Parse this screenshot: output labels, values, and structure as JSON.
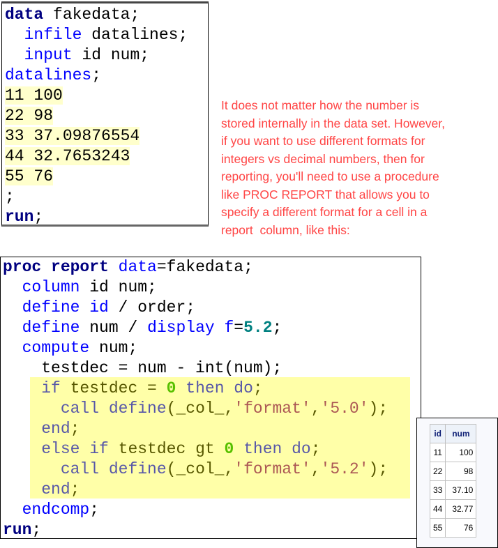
{
  "code1": {
    "lines": [
      [
        {
          "t": "data",
          "k": "kw"
        },
        {
          "t": " fakedata;",
          "k": "plain"
        }
      ],
      [
        {
          "t": "  ",
          "k": "plain"
        },
        {
          "t": "infile",
          "k": "blue"
        },
        {
          "t": " datalines;",
          "k": "plain"
        }
      ],
      [
        {
          "t": "  ",
          "k": "plain"
        },
        {
          "t": "input",
          "k": "blue"
        },
        {
          "t": " id num;",
          "k": "plain"
        }
      ],
      [
        {
          "t": "datalines",
          "k": "blue"
        },
        {
          "t": ";",
          "k": "plain"
        }
      ],
      [
        {
          "t": "11 100",
          "k": "plain hl-data"
        }
      ],
      [
        {
          "t": "22 98",
          "k": "plain hl-data"
        }
      ],
      [
        {
          "t": "33 37.09876554",
          "k": "plain hl-data"
        }
      ],
      [
        {
          "t": "44 32.7653243",
          "k": "plain hl-data"
        }
      ],
      [
        {
          "t": "55 76",
          "k": "plain hl-data"
        }
      ],
      [
        {
          "t": ";",
          "k": "plain"
        }
      ],
      [
        {
          "t": "run",
          "k": "kw"
        },
        {
          "t": ";",
          "k": "plain"
        }
      ]
    ]
  },
  "code2": {
    "lines": [
      [
        {
          "t": "proc report",
          "k": "kw"
        },
        {
          "t": " ",
          "k": "plain"
        },
        {
          "t": "data",
          "k": "blue"
        },
        {
          "t": "=fakedata;",
          "k": "plain"
        }
      ],
      [
        {
          "t": "  ",
          "k": "plain"
        },
        {
          "t": "column",
          "k": "blue"
        },
        {
          "t": " id num;",
          "k": "plain"
        }
      ],
      [
        {
          "t": "  ",
          "k": "plain"
        },
        {
          "t": "define id",
          "k": "blue"
        },
        {
          "t": " / order;",
          "k": "plain"
        }
      ],
      [
        {
          "t": "  ",
          "k": "plain"
        },
        {
          "t": "define",
          "k": "blue"
        },
        {
          "t": " num / ",
          "k": "plain"
        },
        {
          "t": "display f",
          "k": "blue"
        },
        {
          "t": "=",
          "k": "plain"
        },
        {
          "t": "5.2",
          "k": "num"
        },
        {
          "t": ";",
          "k": "plain"
        }
      ],
      [
        {
          "t": "  ",
          "k": "plain"
        },
        {
          "t": "compute",
          "k": "blue"
        },
        {
          "t": " num;",
          "k": "plain"
        }
      ],
      [
        {
          "t": "    testdec = num - int(num);",
          "k": "plain"
        }
      ],
      [
        {
          "t": "    ",
          "k": "plain"
        },
        {
          "t": "if",
          "k": "blue"
        },
        {
          "t": " testdec = ",
          "k": "plain"
        },
        {
          "t": "0",
          "k": "zero"
        },
        {
          "t": " ",
          "k": "plain"
        },
        {
          "t": "then do",
          "k": "blue"
        },
        {
          "t": ";",
          "k": "plain"
        }
      ],
      [
        {
          "t": "      ",
          "k": "plain"
        },
        {
          "t": "call define",
          "k": "blue"
        },
        {
          "t": "(_col_,",
          "k": "plain"
        },
        {
          "t": "'format'",
          "k": "str"
        },
        {
          "t": ",",
          "k": "plain"
        },
        {
          "t": "'5.0'",
          "k": "str"
        },
        {
          "t": ");",
          "k": "plain"
        }
      ],
      [
        {
          "t": "    ",
          "k": "plain"
        },
        {
          "t": "end",
          "k": "blue"
        },
        {
          "t": ";",
          "k": "plain"
        }
      ],
      [
        {
          "t": "    ",
          "k": "plain"
        },
        {
          "t": "else if",
          "k": "blue"
        },
        {
          "t": " testdec gt ",
          "k": "plain"
        },
        {
          "t": "0",
          "k": "zero"
        },
        {
          "t": " ",
          "k": "plain"
        },
        {
          "t": "then do",
          "k": "blue"
        },
        {
          "t": ";",
          "k": "plain"
        }
      ],
      [
        {
          "t": "      ",
          "k": "plain"
        },
        {
          "t": "call define",
          "k": "blue"
        },
        {
          "t": "(_col_,",
          "k": "plain"
        },
        {
          "t": "'format'",
          "k": "str"
        },
        {
          "t": ",",
          "k": "plain"
        },
        {
          "t": "'5.2'",
          "k": "str"
        },
        {
          "t": ");",
          "k": "plain"
        }
      ],
      [
        {
          "t": "    ",
          "k": "plain"
        },
        {
          "t": "end",
          "k": "blue"
        },
        {
          "t": ";",
          "k": "plain"
        }
      ],
      [
        {
          "t": "  ",
          "k": "plain"
        },
        {
          "t": "endcomp",
          "k": "blue"
        },
        {
          "t": ";",
          "k": "plain"
        }
      ],
      [
        {
          "t": "run",
          "k": "kw"
        },
        {
          "t": ";",
          "k": "plain"
        }
      ]
    ]
  },
  "note": {
    "lines": [
      "It does not matter how the number is",
      "stored internally in the data set. However,",
      "if you want to use different formats for",
      "integers vs decimal numbers, then for",
      "reporting, you'll need to use a procedure",
      "like PROC REPORT that allows you to",
      "specify a different format for a cell in a",
      "report  column, like this:"
    ]
  },
  "report": {
    "headers": [
      "id",
      "num"
    ],
    "rows": [
      [
        "11",
        "100"
      ],
      [
        "22",
        "98"
      ],
      [
        "33",
        "37.10"
      ],
      [
        "44",
        "32.77"
      ],
      [
        "55",
        "76"
      ]
    ]
  }
}
